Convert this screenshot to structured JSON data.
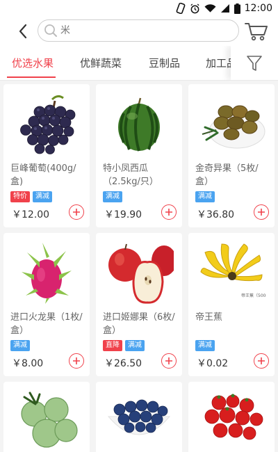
{
  "status_bar": {
    "time": "12:00"
  },
  "search": {
    "placeholder": "米",
    "search_icon": "search-icon"
  },
  "header": {
    "back_icon": "chevron-left-icon",
    "cart_icon": "cart-icon"
  },
  "tabs": [
    {
      "label": "优选水果",
      "active": true
    },
    {
      "label": "优鲜蔬菜",
      "active": false
    },
    {
      "label": "豆制品",
      "active": false
    },
    {
      "label": "加工品",
      "active": false
    }
  ],
  "filter": {
    "icon": "filter-icon"
  },
  "colors": {
    "accent": "#f0414b",
    "tag_red": "#f0414b",
    "tag_blue": "#4aa3f0"
  },
  "products": [
    {
      "name": "巨峰葡萄(400g/盒)",
      "tags": [
        {
          "label": "特价",
          "color": "red"
        },
        {
          "label": "满减",
          "color": "blue"
        }
      ],
      "price": "￥12.00",
      "image": "grape"
    },
    {
      "name": "特小凤西瓜（2.5kg/只）",
      "tags": [
        {
          "label": "满减",
          "color": "blue"
        }
      ],
      "price": "￥19.90",
      "image": "watermelon"
    },
    {
      "name": "金奇异果（5枚/盒）",
      "tags": [
        {
          "label": "满减",
          "color": "blue"
        }
      ],
      "price": "￥36.80",
      "image": "kiwi"
    },
    {
      "name": "进口火龙果（1枚/盒）",
      "tags": [
        {
          "label": "满减",
          "color": "blue"
        }
      ],
      "price": "￥8.00",
      "image": "dragonfruit"
    },
    {
      "name": "进口姬娜果（6枚/盒）",
      "tags": [
        {
          "label": "直降",
          "color": "red"
        },
        {
          "label": "满减",
          "color": "blue"
        }
      ],
      "price": "￥26.50",
      "image": "apple"
    },
    {
      "name": "帝王蕉",
      "tags": [
        {
          "label": "满减",
          "color": "blue"
        }
      ],
      "price": "￥0.02",
      "image": "banana",
      "image_label": "帝王蕉（500g）"
    },
    {
      "name": "",
      "tags": [],
      "price": "",
      "image": "melon"
    },
    {
      "name": "",
      "tags": [],
      "price": "",
      "image": "blueberry"
    },
    {
      "name": "",
      "tags": [],
      "price": "",
      "image": "tomato"
    }
  ]
}
